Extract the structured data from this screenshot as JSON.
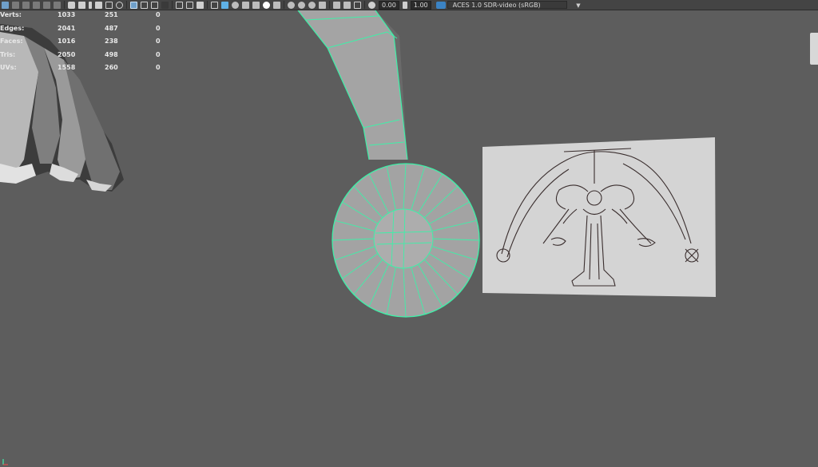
{
  "toolbar": {
    "exposure_value": "0.00",
    "gamma_value": "1.00",
    "colorspace": "ACES 1.0 SDR-video (sRGB)",
    "icons": [
      "select-icon",
      "lasso-icon",
      "paint-icon",
      "move-icon",
      "rotate-icon",
      "scale-icon",
      "camera-icon",
      "camera-attributes-icon",
      "bookmark-icon",
      "image-plane-icon",
      "grid-icon",
      "film-gate-icon",
      "resolution-gate-icon",
      "gate-mask-icon",
      "field-chart-icon",
      "safe-action-icon",
      "safe-title-icon",
      "wireframe-icon",
      "smooth-shade-icon",
      "default-material-icon",
      "bounding-box-icon",
      "textured-icon",
      "use-lights-icon",
      "shadows-icon",
      "screen-ao-icon",
      "motion-blur-icon",
      "antialias-icon",
      "depth-of-field-icon",
      "isolate-select-icon",
      "xray-icon",
      "xray-joints-icon",
      "xray-components-icon",
      "gamma-icon",
      "exposure-icon"
    ]
  },
  "hud": {
    "rows": [
      {
        "label": "Verts:",
        "a": "1033",
        "b": "251",
        "c": "0"
      },
      {
        "label": "Edges:",
        "a": "2041",
        "b": "487",
        "c": "0"
      },
      {
        "label": "Faces:",
        "a": "1016",
        "b": "238",
        "c": "0"
      },
      {
        "label": "Tris:",
        "a": "2050",
        "b": "498",
        "c": "0"
      },
      {
        "label": "UVs:",
        "a": "1558",
        "b": "260",
        "c": "0"
      }
    ]
  },
  "colors": {
    "viewport_bg": "#5d5d5d",
    "selection_highlight": "#3ef0a8",
    "mesh_gray": "#a6a6a6",
    "image_plane": "#d4d4d4",
    "toolbar_bg": "#444444",
    "colorspace_icon": "#3b83c4"
  }
}
